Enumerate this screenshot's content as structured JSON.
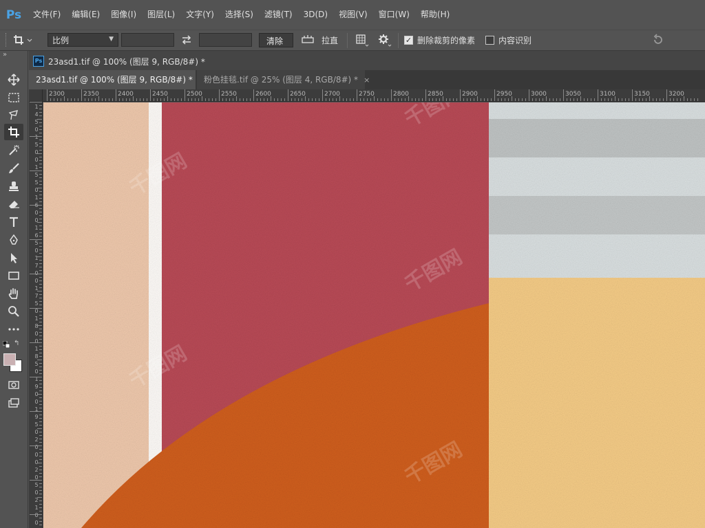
{
  "app": {
    "logo": "Ps"
  },
  "menu": [
    "文件(F)",
    "编辑(E)",
    "图像(I)",
    "图层(L)",
    "文字(Y)",
    "选择(S)",
    "滤镜(T)",
    "3D(D)",
    "视图(V)",
    "窗口(W)",
    "帮助(H)"
  ],
  "options": {
    "ratio_select": "比例",
    "clear_button": "清除",
    "straighten_label": "拉直",
    "delete_cropped_label": "删除裁剪的像素",
    "delete_cropped_checked": true,
    "content_aware_label": "内容识别",
    "content_aware_checked": false
  },
  "document": {
    "title": "23asd1.tif @ 100% (图层 9, RGB/8#) *"
  },
  "tabs": [
    {
      "label": "23asd1.tif @ 100% (图层 9, RGB/8#) *",
      "close": "×",
      "active": true
    },
    {
      "label": "粉色挂毯.tif @ 25% (图层 4, RGB/8#) *",
      "close": "×",
      "active": false
    }
  ],
  "ruler": {
    "horizontal": [
      "2300",
      "2350",
      "2400",
      "2450",
      "2500",
      "2550",
      "2600",
      "2650",
      "2700",
      "2750",
      "2800",
      "2850",
      "2900",
      "2950",
      "3000",
      "3050",
      "3100",
      "3150",
      "3200"
    ],
    "vertical_digits": [
      "1",
      "4",
      "5",
      "0",
      "1",
      "5",
      "0",
      "0",
      "1",
      "5",
      "5",
      "0",
      "1",
      "6",
      "0",
      "0",
      "1",
      "6",
      "5",
      "0",
      "1",
      "7",
      "0",
      "0",
      "1",
      "7",
      "5",
      "0",
      "1",
      "8",
      "0",
      "0",
      "1",
      "8",
      "5",
      "0",
      "1",
      "9",
      "0",
      "0",
      "1",
      "9",
      "5",
      "0",
      "2",
      "0",
      "0",
      "0",
      "2",
      "0",
      "5",
      "0",
      "2",
      "1",
      "0",
      "0"
    ]
  },
  "tools": [
    "move-tool-icon",
    "marquee-tool-icon",
    "lasso-tool-icon",
    "crop-tool-icon",
    "magic-wand-icon",
    "brush-icon",
    "stamp-icon",
    "eraser-icon",
    "type-tool-icon",
    "pen-tool-icon",
    "path-select-icon",
    "rectangle-tool-icon",
    "hand-tool-icon",
    "zoom-tool-icon",
    "more-tools-icon",
    "quick-mask-icon",
    "screen-mode-icon"
  ],
  "colors": {
    "foreground": "#c9b0b2",
    "background": "#ffffff",
    "peach": "#eec8ac",
    "red": "#b84a56",
    "orange": "#cf5e1c",
    "yellow": "#f4cb86",
    "gray_light": "#d9dfe0",
    "gray_dark": "#bfc3c3"
  }
}
